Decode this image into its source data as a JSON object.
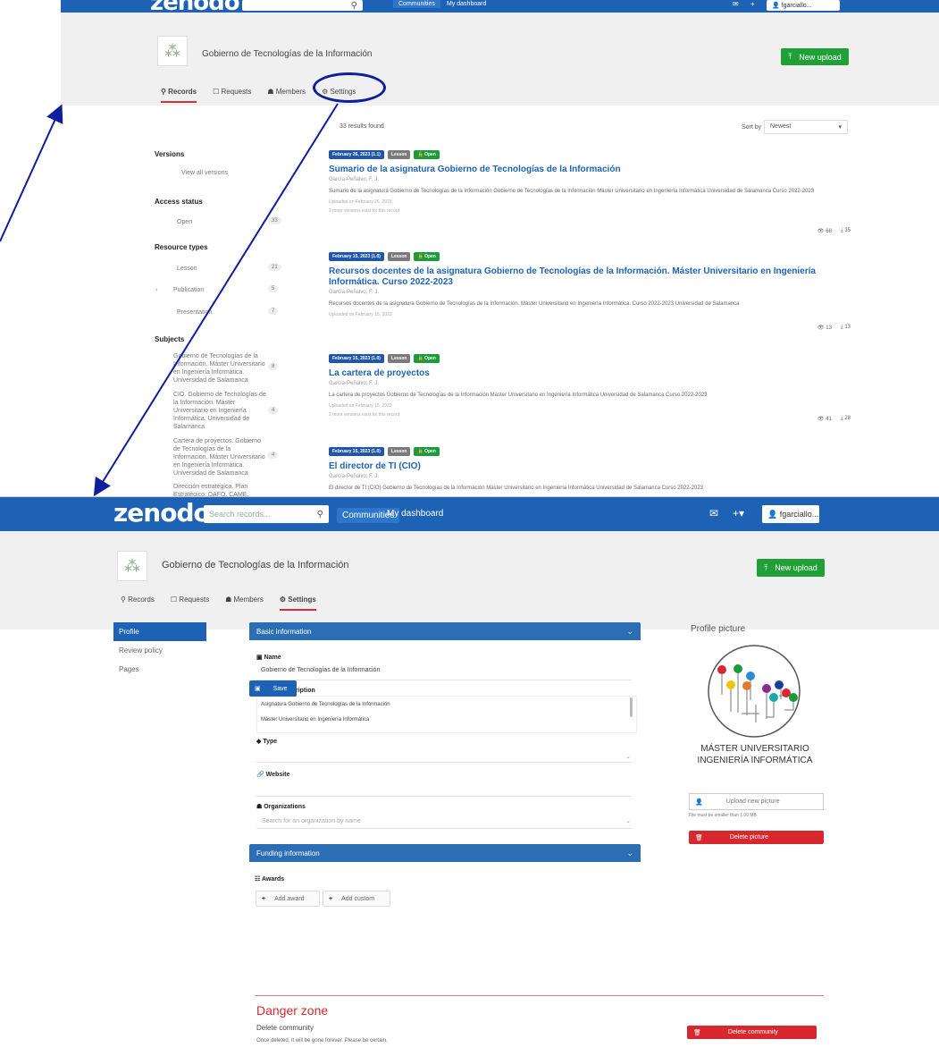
{
  "common": {
    "brand": "zenodo",
    "community_title": "Gobierno de Tecnologías de la Información",
    "new_upload": "New upload",
    "search_placeholder": "Search records...",
    "nav_communities": "Communities",
    "nav_dashboard": "My dashboard",
    "user_label": "fgarciallo..."
  },
  "top": {
    "tabs": [
      "Records",
      "Requests",
      "Members",
      "Settings"
    ],
    "results": "33  results found",
    "sort_label": "Sort by",
    "sort_value": "Newest",
    "facets": {
      "versions_title": "Versions",
      "versions_item": "View all versions",
      "access_title": "Access status",
      "access_item": "Open",
      "access_count": "33",
      "rtypes_title": "Resource types",
      "rtypes": [
        {
          "label": "Lesson",
          "count": "21"
        },
        {
          "label": "Publication",
          "count": "5"
        },
        {
          "label": "Presentation",
          "count": "7"
        }
      ],
      "subjects_title": "Subjects",
      "subjects": [
        {
          "label": "Gobierno de Tecnologías de la Información. Máster Universitario en Ingeniería Informática. Universidad de Salamanca",
          "count": "8"
        },
        {
          "label": "CIO. Gobierno de Tecnologías de la Información. Máster Universitario en Ingeniería Informática. Universidad de Salamanca",
          "count": "4"
        },
        {
          "label": "Cartera de proyectos. Gobierno de Tecnologías de la Información. Máster Universitario en Ingeniería Informática. Universidad de Salamanca",
          "count": "4"
        },
        {
          "label": "Dirección estratégica. Plan Estratégico. DAFO. CAME. Gestión",
          "count": ""
        }
      ]
    },
    "records": [
      {
        "date": "February 26, 2023 (1.1)",
        "type": "Lesson",
        "access": "Open",
        "title": "Sumario de la asignatura Gobierno de Tecnologías de la Información",
        "authors": "García-Peñalvo, F. J.",
        "desc": "Sumario de la asignatura Gobierno de Tecnologías de la Información Gobierno de Tecnologías de la Información Máster Universitario en Ingeniería Informática Universidad de Salamanca Curso 2022-2023",
        "meta1": "Uploaded on February 26, 2023",
        "meta2": "2 more versions exist for this record",
        "views": "68",
        "downloads": "35"
      },
      {
        "date": "February 15, 2023 (1.0)",
        "type": "Lesson",
        "access": "Open",
        "title": "Recursos docentes de la asignatura Gobierno de Tecnologías de la Información. Máster Universitario en Ingeniería Informática. Curso 2022-2023",
        "authors": "García-Peñalvo, F. J.",
        "desc": "Recursos docentes de la asignatura Gobierno de Tecnologías de la Información. Máster Universitario en Ingeniería Informática. Curso 2022-2023 Universidad de Salamanca",
        "meta1": "Uploaded on February 15, 2023",
        "meta2": "",
        "views": "13",
        "downloads": "13"
      },
      {
        "date": "February 15, 2023 (1.0)",
        "type": "Lesson",
        "access": "Open",
        "title": "La cartera de proyectos",
        "authors": "García-Peñalvo, F. J.",
        "desc": "La cartera de proyectos Gobierno de Tecnologías de la Información Máster Universitario en Ingeniería Informática Universidad de Salamanca Curso 2022-2023",
        "meta1": "Uploaded on February 15, 2023",
        "meta2": "2 more versions exist for this record",
        "views": "41",
        "downloads": "28"
      },
      {
        "date": "February 15, 2023 (1.0)",
        "type": "Lesson",
        "access": "Open",
        "title": "El director de TI (CIO)",
        "authors": "García-Peñalvo, F. J.",
        "desc": "El director de TI (CIO) Gobierno de Tecnologías de la Información Máster Universitario en Ingeniería Informática Universidad de Salamanca Curso 2022-2023",
        "meta1": "",
        "meta2": "",
        "views": "",
        "downloads": ""
      }
    ]
  },
  "settings": {
    "tabs": [
      "Records",
      "Requests",
      "Members",
      "Settings"
    ],
    "menu": [
      "Profile",
      "Review policy",
      "Pages"
    ],
    "basic_info": "Basic information",
    "name_label": "Name",
    "name_value": "Gobierno de Tecnologías de la Información",
    "short_desc_label": "Short description",
    "short_desc_line1": "Asignatura Gobierno de Tecnologías de la Información",
    "short_desc_line2": "Máster Universitario en Ingeniería Informática",
    "type_label": "Type",
    "website_label": "Website",
    "orgs_label": "Organizations",
    "orgs_placeholder": "Search for an organization by name",
    "funding_info": "Funding information",
    "awards_label": "Awards",
    "add_award": "Add award",
    "add_custom": "Add custom",
    "save": "Save",
    "profile_picture": "Profile picture",
    "logo_line1": "MÁSTER UNIVERSITARIO",
    "logo_line2": "INGENIERÍA INFORMÁTICA",
    "upload_picture": "Upload new picture",
    "file_hint": "File must be smaller than 1.00 MB",
    "delete_picture": "Delete picture",
    "danger_zone": "Danger zone",
    "delete_community_title": "Delete community",
    "delete_note": "Once deleted, it will be gone forever. Please be certain.",
    "delete_community_btn": "Delete community"
  },
  "annotation_color": "#0f1e9c"
}
